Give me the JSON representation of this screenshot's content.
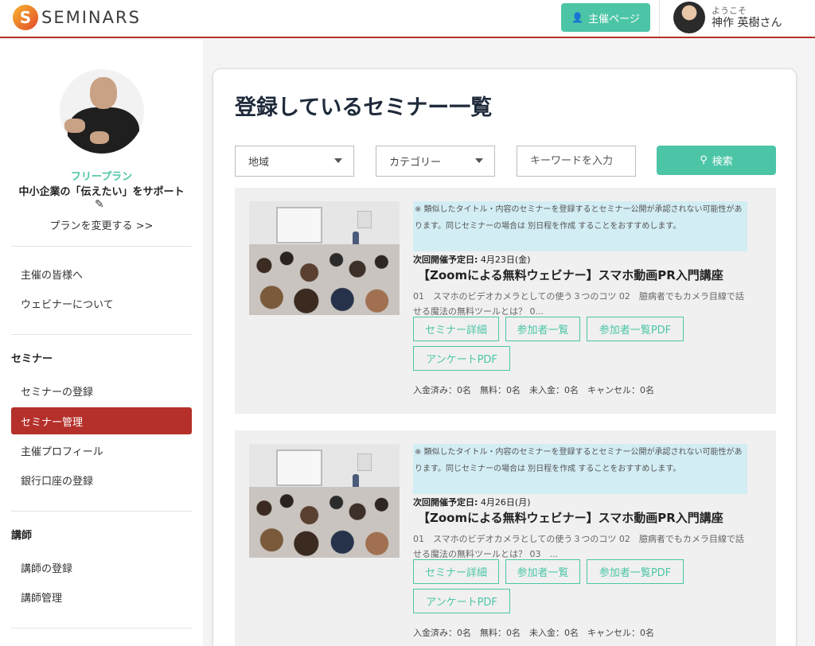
{
  "header": {
    "logo_letter": "S",
    "logo_text": "SEMINARS",
    "host_page_button": "主催ページ",
    "welcome": "ようこそ",
    "username": "神作 英樹さん"
  },
  "sidebar": {
    "plan": "フリープラン",
    "plan_desc": "中小企業の「伝えたい」をサポート",
    "change_plan": "プランを変更する >>",
    "links_top": [
      "主催の皆様へ",
      "ウェビナーについて"
    ],
    "sections": [
      {
        "title": "セミナー",
        "items": [
          "セミナーの登録",
          "セミナー管理",
          "主催プロフィール",
          "銀行口座の登録"
        ],
        "active": 1
      },
      {
        "title": "講師",
        "items": [
          "講師の登録",
          "講師管理"
        ]
      }
    ]
  },
  "main": {
    "title": "登録しているセミナー一覧",
    "filters": {
      "region": "地域",
      "category": "カテゴリー",
      "keyword_placeholder": "キーワードを入力",
      "search_button": "検索"
    },
    "seminars": [
      {
        "notice": "※ 類似したタイトル・内容のセミナーを登録するとセミナー公開が承認されない可能性があります。同じセミナーの場合は 別日程を作成 することをおすすめします。",
        "date_label": "次回開催予定日:",
        "date": "4月23日(金)",
        "title": "【Zoomによる無料ウェビナー】スマホ動画PR入門講座",
        "description": "01　スマホのビデオカメラとしての使う３つのコツ 02　臆病者でもカメラ目線で話せる魔法の無料ツールとは？ 0...",
        "buttons": [
          "セミナー詳細",
          "参加者一覧",
          "参加者一覧PDF",
          "アンケートPDF"
        ],
        "stats": "入金済み：0名　無料：0名　未入金：0名　キャンセル：0名"
      },
      {
        "notice": "※ 類似したタイトル・内容のセミナーを登録するとセミナー公開が承認されない可能性があります。同じセミナーの場合は 別日程を作成 することをおすすめします。",
        "date_label": "次回開催予定日:",
        "date": "4月26日(月)",
        "title": "【Zoomによる無料ウェビナー】スマホ動画PR入門講座",
        "description": "01　スマホのビデオカメラとしての使う３つのコツ 02　臆病者でもカメラ目線で話せる魔法の無料ツールとは？ 03　...",
        "buttons": [
          "セミナー詳細",
          "参加者一覧",
          "参加者一覧PDF",
          "アンケートPDF"
        ],
        "stats": "入金済み：0名　無料：0名　未入金：0名　キャンセル：0名"
      }
    ]
  },
  "colors": {
    "accent": "#4cc5a7",
    "brand_red": "#b5302a",
    "notice_bg": "#d3edf4"
  }
}
